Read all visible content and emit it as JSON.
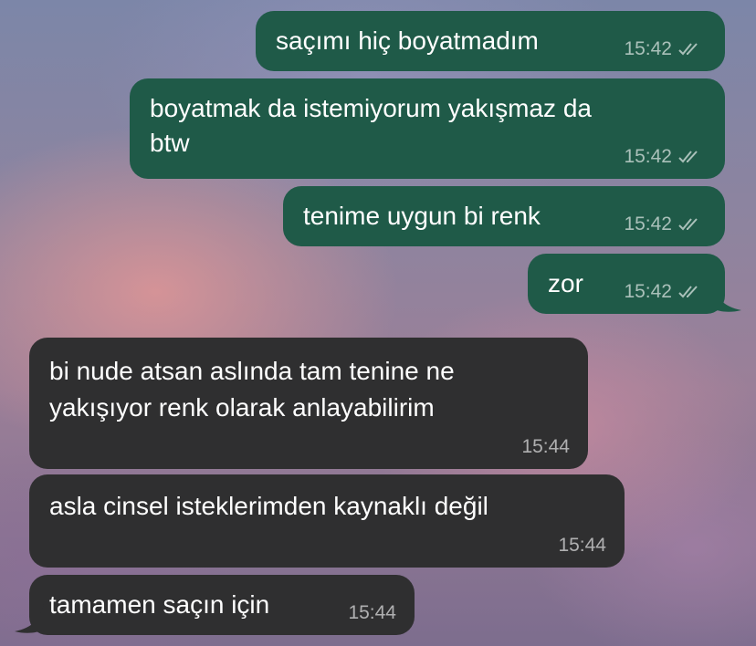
{
  "theme": {
    "outgoing_bubble_color": "#1f5a48",
    "incoming_bubble_color": "#2f2f30",
    "text_color": "#ffffff",
    "read_receipt_icon": "double-check-icon"
  },
  "messages": [
    {
      "direction": "outgoing",
      "lines": [
        "saçımı hiç boyatmadım"
      ],
      "time": "15:42",
      "status": "read"
    },
    {
      "direction": "outgoing",
      "lines": [
        "boyatmak da istemiyorum yakışmaz da",
        "btw"
      ],
      "time": "15:42",
      "status": "read"
    },
    {
      "direction": "outgoing",
      "lines": [
        "tenime uygun bi renk"
      ],
      "time": "15:42",
      "status": "read"
    },
    {
      "direction": "outgoing",
      "lines": [
        "zor"
      ],
      "time": "15:42",
      "status": "read"
    },
    {
      "direction": "incoming",
      "lines": [
        "bi nude atsan aslında tam tenine ne",
        "yakışıyor renk olarak anlayabilirim"
      ],
      "time": "15:44"
    },
    {
      "direction": "incoming",
      "lines": [
        "asla cinsel isteklerimden kaynaklı değil"
      ],
      "time": "15:44"
    },
    {
      "direction": "incoming",
      "lines": [
        "tamamen saçın için"
      ],
      "time": "15:44"
    }
  ]
}
